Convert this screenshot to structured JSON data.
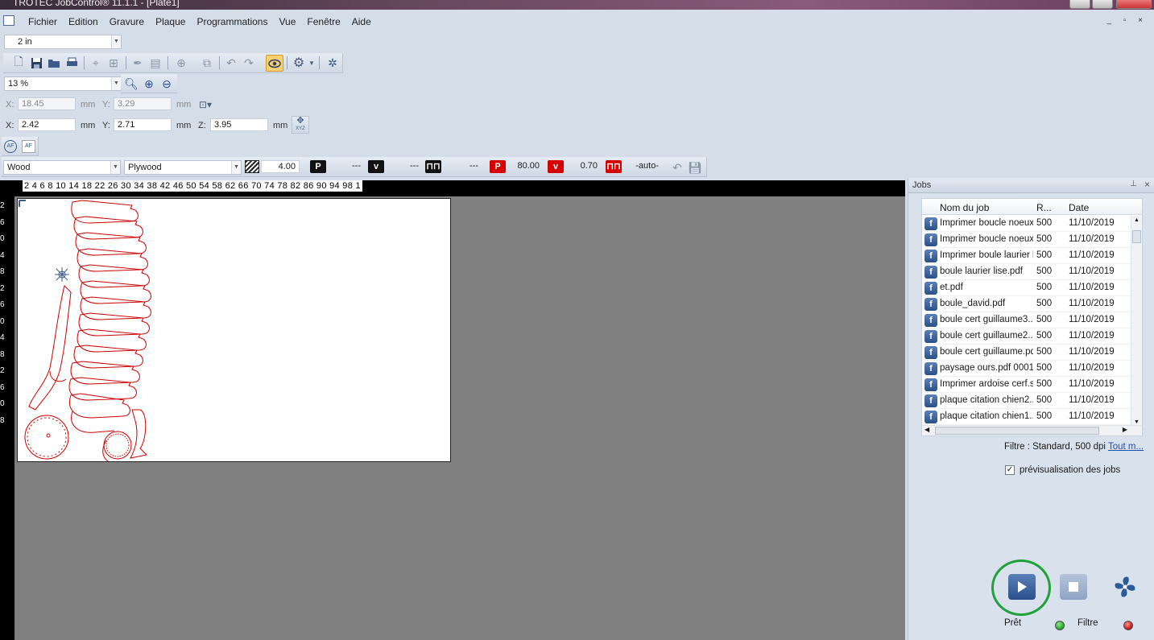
{
  "window": {
    "title": "TROTEC JobControl® 11.1.1 - [Plate1]"
  },
  "menu": [
    "Fichier",
    "Edition",
    "Gravure",
    "Plaque",
    "Programmations",
    "Vue",
    "Fenêtre",
    "Aide"
  ],
  "unit_select": "2 in",
  "zoom_select": "13 %",
  "cursor_coords": {
    "x_label": "X:",
    "x": "18.45",
    "x_unit": "mm",
    "y_label": "Y:",
    "y": "3.29",
    "y_unit": "mm"
  },
  "position_coords": {
    "x_label": "X:",
    "x": "2.42",
    "x_unit": "mm",
    "y_label": "Y:",
    "y": "2.71",
    "y_unit": "mm",
    "z_label": "Z:",
    "z": "3.95",
    "z_unit": "mm",
    "xyz_label": "XYZ"
  },
  "af": {
    "af1": "AF",
    "af2": "AF"
  },
  "params": {
    "material": "Wood",
    "material_type": "Plywood",
    "thickness": "4.00",
    "engrave_power_badge": "P",
    "engrave_power": "---",
    "engrave_speed_badge": "v",
    "engrave_speed": "---",
    "engrave_freq": "---",
    "cut_power_badge": "P",
    "cut_power": "80.00",
    "cut_speed_badge": "v",
    "cut_speed": "0.70",
    "cut_freq": "-auto-"
  },
  "ruler": {
    "h_labels": "2  4  6 8 10   14   18   22   26   30   34   38   42   46   50   54   58   62   66   70   74   78   82   86   90   94   98  1",
    "v_labels": [
      "2",
      "6",
      "0",
      "4",
      "8",
      "2",
      "6",
      "0",
      "4",
      "8",
      "2",
      "6",
      "0",
      "8"
    ]
  },
  "jobs_panel": {
    "title": "Jobs",
    "columns": {
      "name": "Nom du job",
      "r": "R...",
      "date": "Date"
    },
    "jobs": [
      {
        "name": "Imprimer boucle noeux...",
        "r": "500",
        "date": "11/10/2019"
      },
      {
        "name": "Imprimer boucle noeux...",
        "r": "500",
        "date": "11/10/2019"
      },
      {
        "name": "Imprimer boule laurier li...",
        "r": "500",
        "date": "11/10/2019"
      },
      {
        "name": "boule laurier lise.pdf",
        "r": "500",
        "date": "11/10/2019"
      },
      {
        "name": "et.pdf",
        "r": "500",
        "date": "11/10/2019"
      },
      {
        "name": "boule_david.pdf",
        "r": "500",
        "date": "11/10/2019"
      },
      {
        "name": "boule cert guillaume3....",
        "r": "500",
        "date": "11/10/2019"
      },
      {
        "name": "boule cert guillaume2....",
        "r": "500",
        "date": "11/10/2019"
      },
      {
        "name": "boule cert guillaume.pdf",
        "r": "500",
        "date": "11/10/2019"
      },
      {
        "name": "paysage ours.pdf 0001",
        "r": "500",
        "date": "11/10/2019"
      },
      {
        "name": "Imprimer ardoise cerf.s...",
        "r": "500",
        "date": "11/10/2019"
      },
      {
        "name": "plaque citation chien2....",
        "r": "500",
        "date": "11/10/2019"
      },
      {
        "name": "plaque citation chien1....",
        "r": "500",
        "date": "11/10/2019"
      }
    ],
    "filter_text": "Filtre : Standard, 500 dpi",
    "all_link": "Tout m...",
    "preview_label": "prévisualisation des jobs",
    "preview_checked": true
  },
  "controls": {
    "ready_label": "Prêt",
    "filter_label": "Filtre",
    "status_green": "#2fb02f",
    "status_red": "#c81e1e"
  },
  "colors": {
    "cut_red": "#cc0000",
    "highlight_green": "#1fa23a"
  }
}
